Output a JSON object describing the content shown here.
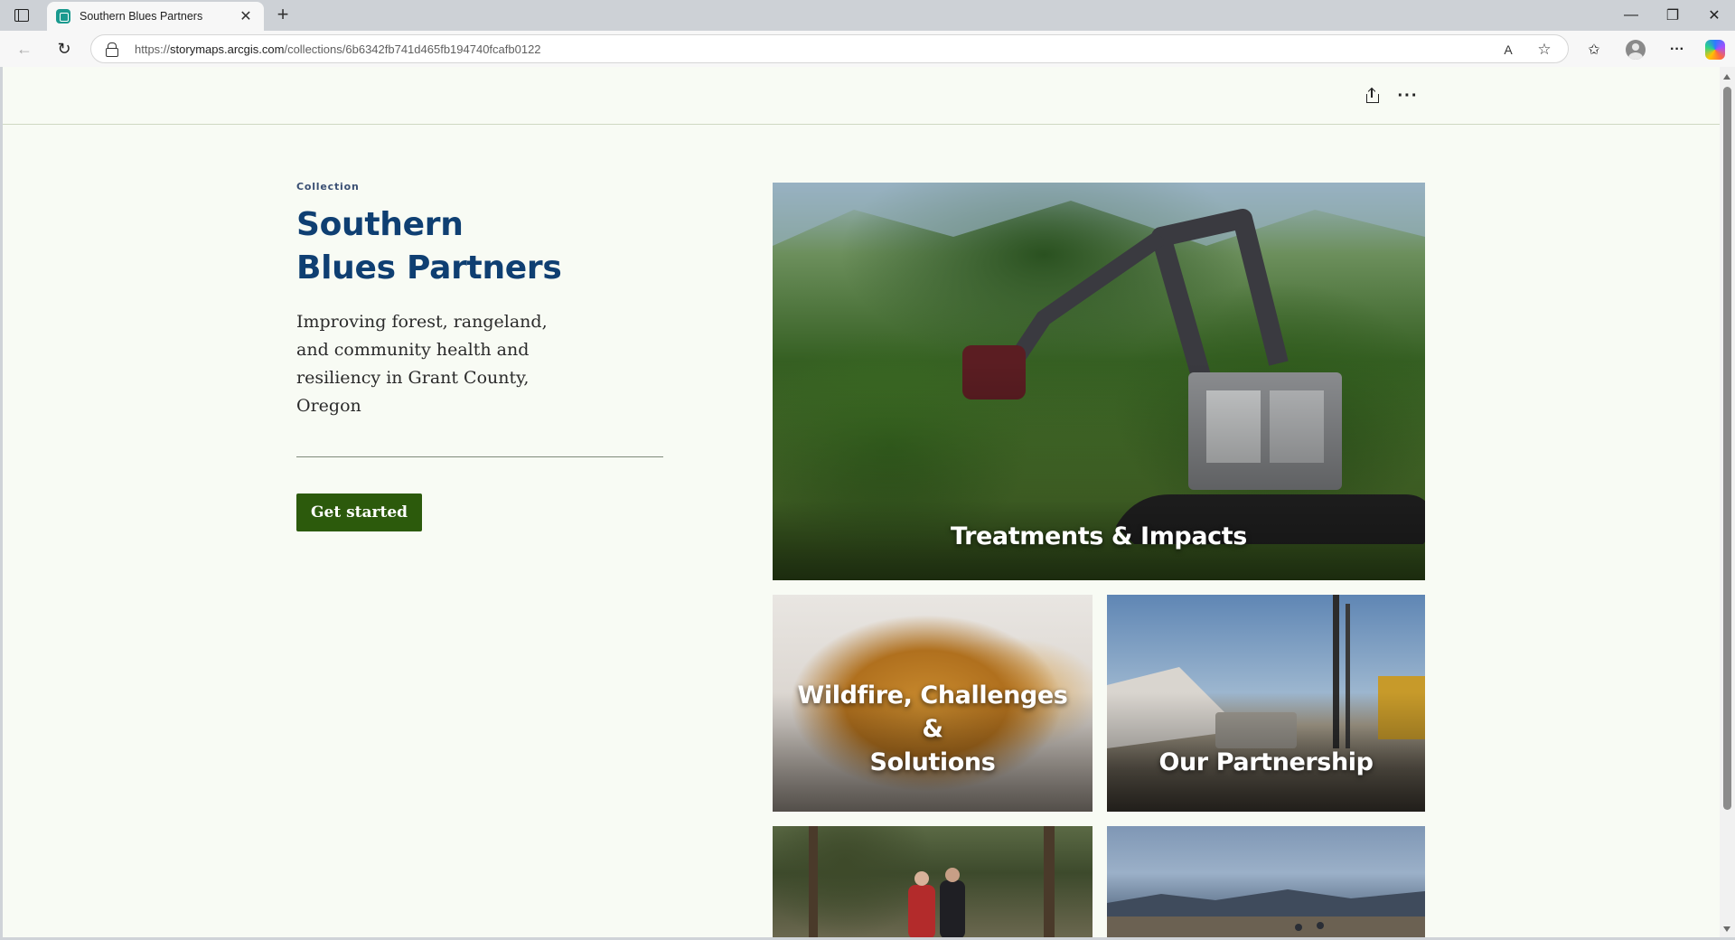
{
  "browser": {
    "tab_title": "Southern Blues Partners",
    "url_prefix": "https://",
    "url_host": "storymaps.arcgis.com",
    "url_path": "/collections/6b6342fb741d465fb194740fcafb0122",
    "new_tab_symbol": "+",
    "close_symbol": "✕",
    "minimize_symbol": "—",
    "restore_symbol": "❐",
    "window_close_symbol": "✕",
    "back_symbol": "←",
    "reload_symbol": "↻",
    "read_aloud_symbol": "A",
    "favorite_symbol": "☆",
    "favorites_symbol": "✩",
    "more_symbol": "···"
  },
  "header": {
    "share_icon": "share-icon",
    "more_symbol": "···"
  },
  "intro": {
    "eyebrow": "Collection",
    "title_line1": "Southern",
    "title_line2": "Blues Partners",
    "summary_line1": "Improving forest, rangeland,",
    "summary_line2": "and community health and",
    "summary_line3": "resiliency in Grant County, Oregon",
    "cta_label": "Get started"
  },
  "cards": [
    {
      "label": "Treatments & Impacts"
    },
    {
      "label_line1": "Wildfire, Challenges &",
      "label_line2": "Solutions"
    },
    {
      "label": "Our Partnership"
    }
  ],
  "colors": {
    "title": "#0f3f72",
    "cta_bg": "#2c5a0c",
    "page_bg": "#f8fbf4"
  }
}
